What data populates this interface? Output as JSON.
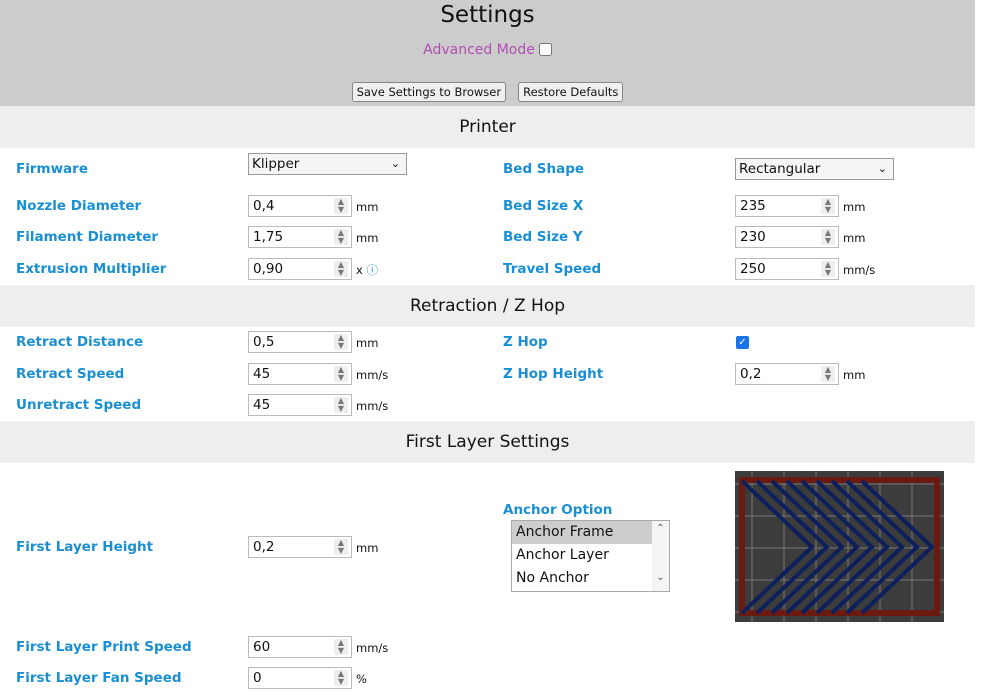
{
  "header": {
    "title": "Settings",
    "advanced_mode_label": "Advanced Mode",
    "advanced_mode_checked": false,
    "save_label": "Save Settings to Browser",
    "restore_label": "Restore Defaults"
  },
  "sections": {
    "printer": "Printer",
    "retraction": "Retraction / Z Hop",
    "first_layer": "First Layer Settings"
  },
  "printer": {
    "firmware": {
      "label": "Firmware",
      "value": "Klipper"
    },
    "nozzle": {
      "label": "Nozzle Diameter",
      "value": "0,4",
      "unit": "mm"
    },
    "filament": {
      "label": "Filament Diameter",
      "value": "1,75",
      "unit": "mm"
    },
    "extrusion": {
      "label": "Extrusion Multiplier",
      "value": "0,90",
      "unit": "x",
      "info_icon": "info-icon"
    },
    "bed_shape": {
      "label": "Bed Shape",
      "value": "Rectangular"
    },
    "bed_x": {
      "label": "Bed Size X",
      "value": "235",
      "unit": "mm"
    },
    "bed_y": {
      "label": "Bed Size Y",
      "value": "230",
      "unit": "mm"
    },
    "travel": {
      "label": "Travel Speed",
      "value": "250",
      "unit": "mm/s"
    }
  },
  "retraction": {
    "distance": {
      "label": "Retract Distance",
      "value": "0,5",
      "unit": "mm"
    },
    "speed": {
      "label": "Retract Speed",
      "value": "45",
      "unit": "mm/s"
    },
    "unretract": {
      "label": "Unretract Speed",
      "value": "45",
      "unit": "mm/s"
    },
    "zhop": {
      "label": "Z Hop",
      "checked": true
    },
    "zhop_height": {
      "label": "Z Hop Height",
      "value": "0,2",
      "unit": "mm"
    }
  },
  "first_layer": {
    "height": {
      "label": "First Layer Height",
      "value": "0,2",
      "unit": "mm"
    },
    "print_speed": {
      "label": "First Layer Print Speed",
      "value": "60",
      "unit": "mm/s"
    },
    "fan_speed": {
      "label": "First Layer Fan Speed",
      "value": "0",
      "unit": "%"
    },
    "anchor": {
      "label": "Anchor Option",
      "options": [
        "Anchor Frame",
        "Anchor Layer",
        "No Anchor"
      ],
      "selected": "Anchor Frame"
    }
  },
  "colors": {
    "label": "#1a8fd1",
    "advanced": "#b04fb0",
    "frame": "#6b1a10",
    "chevron": "#0d1f5c",
    "bed": "#3c3c3c"
  }
}
